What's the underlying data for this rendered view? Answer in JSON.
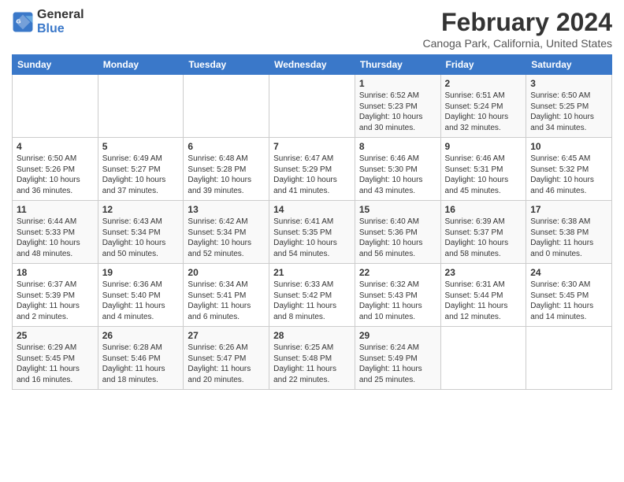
{
  "header": {
    "logo": {
      "line1": "General",
      "line2": "Blue"
    },
    "title": "February 2024",
    "subtitle": "Canoga Park, California, United States"
  },
  "days_of_week": [
    "Sunday",
    "Monday",
    "Tuesday",
    "Wednesday",
    "Thursday",
    "Friday",
    "Saturday"
  ],
  "weeks": [
    [
      {
        "day": "",
        "info": ""
      },
      {
        "day": "",
        "info": ""
      },
      {
        "day": "",
        "info": ""
      },
      {
        "day": "",
        "info": ""
      },
      {
        "day": "1",
        "info": "Sunrise: 6:52 AM\nSunset: 5:23 PM\nDaylight: 10 hours and 30 minutes."
      },
      {
        "day": "2",
        "info": "Sunrise: 6:51 AM\nSunset: 5:24 PM\nDaylight: 10 hours and 32 minutes."
      },
      {
        "day": "3",
        "info": "Sunrise: 6:50 AM\nSunset: 5:25 PM\nDaylight: 10 hours and 34 minutes."
      }
    ],
    [
      {
        "day": "4",
        "info": "Sunrise: 6:50 AM\nSunset: 5:26 PM\nDaylight: 10 hours and 36 minutes."
      },
      {
        "day": "5",
        "info": "Sunrise: 6:49 AM\nSunset: 5:27 PM\nDaylight: 10 hours and 37 minutes."
      },
      {
        "day": "6",
        "info": "Sunrise: 6:48 AM\nSunset: 5:28 PM\nDaylight: 10 hours and 39 minutes."
      },
      {
        "day": "7",
        "info": "Sunrise: 6:47 AM\nSunset: 5:29 PM\nDaylight: 10 hours and 41 minutes."
      },
      {
        "day": "8",
        "info": "Sunrise: 6:46 AM\nSunset: 5:30 PM\nDaylight: 10 hours and 43 minutes."
      },
      {
        "day": "9",
        "info": "Sunrise: 6:46 AM\nSunset: 5:31 PM\nDaylight: 10 hours and 45 minutes."
      },
      {
        "day": "10",
        "info": "Sunrise: 6:45 AM\nSunset: 5:32 PM\nDaylight: 10 hours and 46 minutes."
      }
    ],
    [
      {
        "day": "11",
        "info": "Sunrise: 6:44 AM\nSunset: 5:33 PM\nDaylight: 10 hours and 48 minutes."
      },
      {
        "day": "12",
        "info": "Sunrise: 6:43 AM\nSunset: 5:34 PM\nDaylight: 10 hours and 50 minutes."
      },
      {
        "day": "13",
        "info": "Sunrise: 6:42 AM\nSunset: 5:34 PM\nDaylight: 10 hours and 52 minutes."
      },
      {
        "day": "14",
        "info": "Sunrise: 6:41 AM\nSunset: 5:35 PM\nDaylight: 10 hours and 54 minutes."
      },
      {
        "day": "15",
        "info": "Sunrise: 6:40 AM\nSunset: 5:36 PM\nDaylight: 10 hours and 56 minutes."
      },
      {
        "day": "16",
        "info": "Sunrise: 6:39 AM\nSunset: 5:37 PM\nDaylight: 10 hours and 58 minutes."
      },
      {
        "day": "17",
        "info": "Sunrise: 6:38 AM\nSunset: 5:38 PM\nDaylight: 11 hours and 0 minutes."
      }
    ],
    [
      {
        "day": "18",
        "info": "Sunrise: 6:37 AM\nSunset: 5:39 PM\nDaylight: 11 hours and 2 minutes."
      },
      {
        "day": "19",
        "info": "Sunrise: 6:36 AM\nSunset: 5:40 PM\nDaylight: 11 hours and 4 minutes."
      },
      {
        "day": "20",
        "info": "Sunrise: 6:34 AM\nSunset: 5:41 PM\nDaylight: 11 hours and 6 minutes."
      },
      {
        "day": "21",
        "info": "Sunrise: 6:33 AM\nSunset: 5:42 PM\nDaylight: 11 hours and 8 minutes."
      },
      {
        "day": "22",
        "info": "Sunrise: 6:32 AM\nSunset: 5:43 PM\nDaylight: 11 hours and 10 minutes."
      },
      {
        "day": "23",
        "info": "Sunrise: 6:31 AM\nSunset: 5:44 PM\nDaylight: 11 hours and 12 minutes."
      },
      {
        "day": "24",
        "info": "Sunrise: 6:30 AM\nSunset: 5:45 PM\nDaylight: 11 hours and 14 minutes."
      }
    ],
    [
      {
        "day": "25",
        "info": "Sunrise: 6:29 AM\nSunset: 5:45 PM\nDaylight: 11 hours and 16 minutes."
      },
      {
        "day": "26",
        "info": "Sunrise: 6:28 AM\nSunset: 5:46 PM\nDaylight: 11 hours and 18 minutes."
      },
      {
        "day": "27",
        "info": "Sunrise: 6:26 AM\nSunset: 5:47 PM\nDaylight: 11 hours and 20 minutes."
      },
      {
        "day": "28",
        "info": "Sunrise: 6:25 AM\nSunset: 5:48 PM\nDaylight: 11 hours and 22 minutes."
      },
      {
        "day": "29",
        "info": "Sunrise: 6:24 AM\nSunset: 5:49 PM\nDaylight: 11 hours and 25 minutes."
      },
      {
        "day": "",
        "info": ""
      },
      {
        "day": "",
        "info": ""
      }
    ]
  ]
}
